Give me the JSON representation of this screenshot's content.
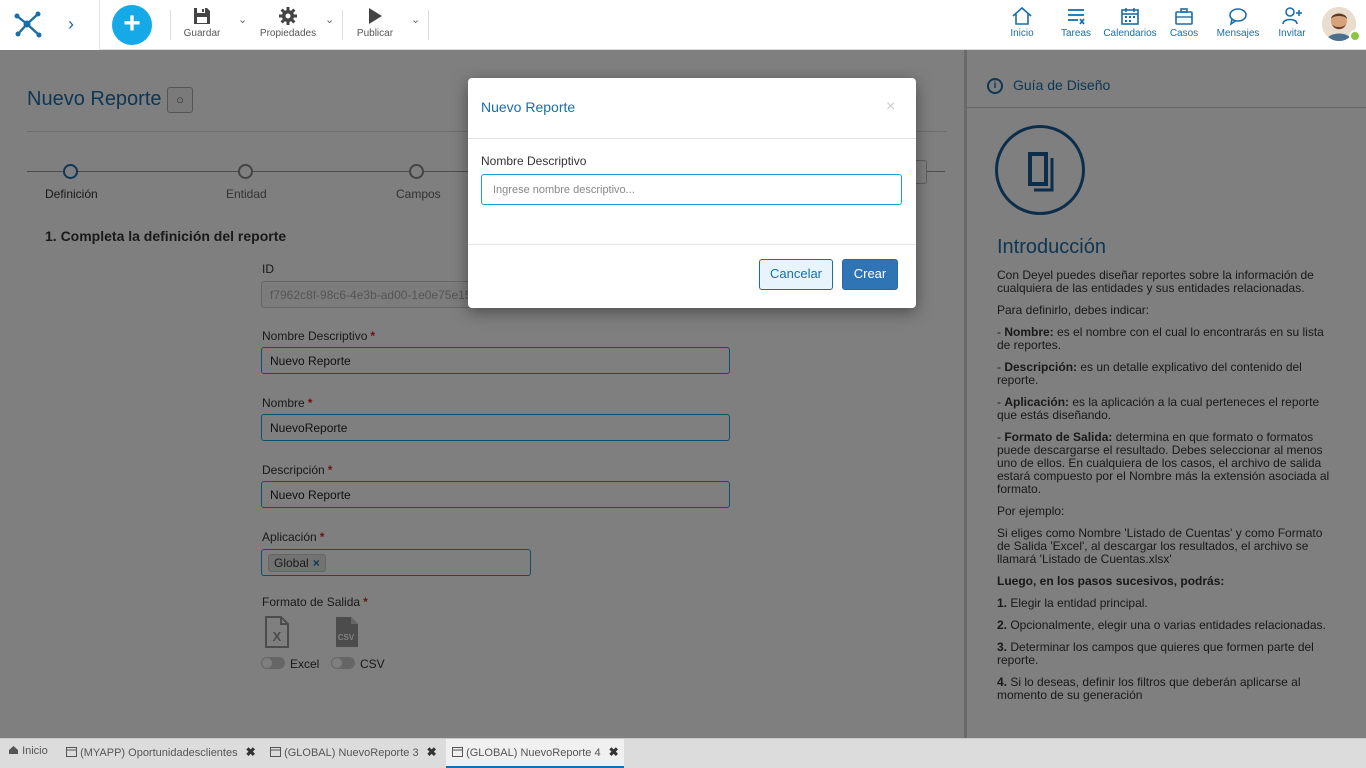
{
  "toolbar": {
    "save_label": "Guardar",
    "properties_label": "Propiedades",
    "publish_label": "Publicar"
  },
  "nav": {
    "home": "Inicio",
    "tasks": "Tareas",
    "calendars": "Calendarios",
    "cases": "Casos",
    "messages": "Mensajes",
    "invite": "Invitar"
  },
  "page": {
    "title": "Nuevo Reporte",
    "status_symbol": "○"
  },
  "steps": [
    {
      "label": "Definición",
      "active": true
    },
    {
      "label": "Entidad",
      "active": false
    },
    {
      "label": "Campos",
      "active": false
    }
  ],
  "form": {
    "section_title": "1. Completa la definición del reporte",
    "id_label": "ID",
    "id_value": "f7962c8f-98c6-4e3b-ad00-1e0e75e157",
    "descriptive_name_label": "Nombre Descriptivo",
    "descriptive_name_value": "Nuevo Reporte",
    "name_label": "Nombre",
    "name_value": "NuevoReporte",
    "description_label": "Descripción",
    "description_value": "Nuevo Reporte",
    "application_label": "Aplicación",
    "application_tag": "Global",
    "required_mark": "*",
    "output_format_label": "Formato de Salida",
    "excel_label": "Excel",
    "csv_label": "CSV",
    "csv_icon_text": "CSV",
    "excel_icon_text": "X"
  },
  "guide": {
    "title": "Guía de Diseño",
    "heading": "Introducción",
    "paragraphs": {
      "p1": "Con Deyel puedes diseñar reportes sobre la información de cualquiera de las entidades y sus entidades relacionadas.",
      "p2": "Para definirlo, debes indicar:",
      "p3_bold": "Nombre:",
      "p3": " es el nombre con el cual lo encontrarás en su lista de reportes.",
      "p4_bold": "Descripción:",
      "p4": " es un detalle explicativo del contenido del reporte.",
      "p5_bold": "Aplicación:",
      "p5": " es la aplicación a la cual perteneces el reporte que estás diseñando.",
      "p6_bold": "Formato de Salida:",
      "p6": " determina en que formato o formatos puede descargarse el resultado. Debes seleccionar al menos uno de ellos. En cualquiera de los casos, el archivo de salida estará compuesto por el Nombre más la extensión asociada al formato.",
      "p7": "Por ejemplo:",
      "p8": "Si eliges como Nombre 'Listado de Cuentas' y como Formato de Salida 'Excel', al descargar los resultados, el archivo se llamará 'Listado de Cuentas.xlsx'",
      "p9": "Luego, en los pasos sucesivos, podrás:",
      "p10_bold": "1.",
      "p10": " Elegir la entidad principal.",
      "p11_bold": "2.",
      "p11": " Opcionalmente, elegir una o varias entidades relacionadas.",
      "p12_bold": "3.",
      "p12": " Determinar los campos que quieres que formen parte del reporte.",
      "p13_bold": "4.",
      "p13": " Si lo deseas, definir los filtros que deberán aplicarse al momento de su generación",
      "dash": "- "
    }
  },
  "modal": {
    "title": "Nuevo Reporte",
    "close_symbol": "×",
    "field_label": "Nombre Descriptivo",
    "field_placeholder": "Ingrese nombre descriptivo...",
    "cancel_label": "Cancelar",
    "create_label": "Crear"
  },
  "bottom_tabs": [
    {
      "label": "Inicio",
      "closable": false,
      "active": false
    },
    {
      "label": "(MYAPP) Oportunidadesclientes",
      "closable": true,
      "active": false
    },
    {
      "label": "(GLOBAL) NuevoReporte 3",
      "closable": true,
      "active": false
    },
    {
      "label": "(GLOBAL) NuevoReporte 4",
      "closable": true,
      "active": true
    }
  ],
  "colors": {
    "accent": "#1a6ea8",
    "add_button": "#16a9e7",
    "primary_button": "#2f75b5",
    "required": "#d9232d",
    "online": "#8cc63f"
  },
  "icons": {
    "close_tab": "✖",
    "tag_remove": "×",
    "info": "i",
    "add": "+",
    "chevron": "›",
    "caret": "⌄"
  }
}
